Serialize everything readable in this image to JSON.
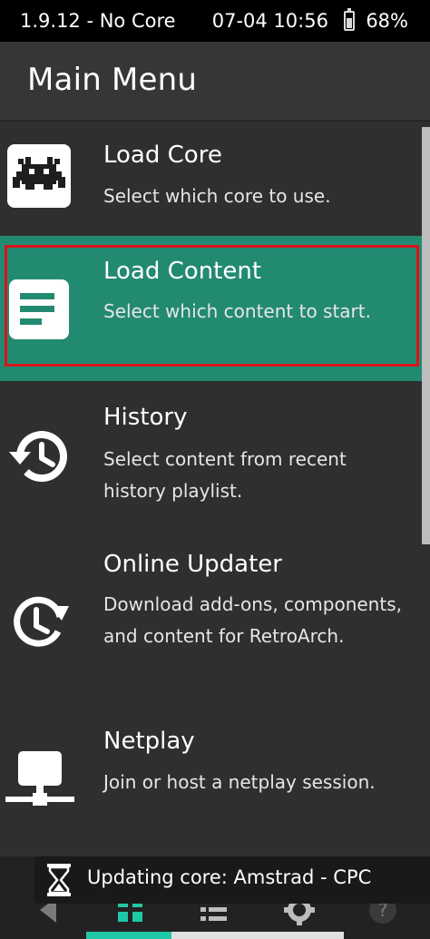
{
  "status_bar": {
    "left_text": "1.9.12 - No Core",
    "datetime": "07-04 10:56",
    "battery_percent": "68%",
    "battery_level": 0.68
  },
  "header": {
    "title": "Main Menu"
  },
  "menu": {
    "items": [
      {
        "title": "Load Core",
        "description": "Select which core to use.",
        "icon": "retroarch-invader-icon",
        "selected": false
      },
      {
        "title": "Load Content",
        "description": "Select which content to start.",
        "icon": "document-lines-icon",
        "selected": true
      },
      {
        "title": "History",
        "description": "Select content from recent history playlist.",
        "icon": "history-clock-icon",
        "selected": false
      },
      {
        "title": "Online Updater",
        "description": "Download add-ons, components, and content for RetroArch.",
        "icon": "updater-clock-icon",
        "selected": false
      },
      {
        "title": "Netplay",
        "description": "Join or host a netplay session.",
        "icon": "network-icon",
        "selected": false
      }
    ]
  },
  "toast": {
    "icon": "hourglass-icon",
    "text": "Updating core: Amstrad - CPC"
  },
  "bottom_nav": {
    "tabs": [
      "back-icon",
      "main-menu-icon",
      "playlists-icon",
      "settings-icon",
      "help-icon"
    ],
    "active_tab": 1,
    "progress": 0.33
  },
  "colors": {
    "selected_bg": "#238a72",
    "highlight_border": "#d8141b",
    "accent": "#20c7a6"
  }
}
